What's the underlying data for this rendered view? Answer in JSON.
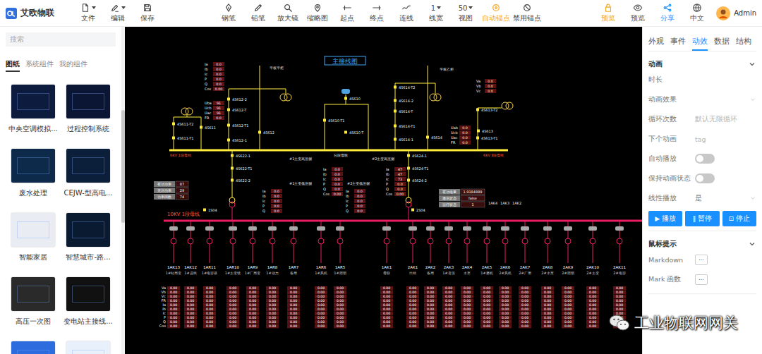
{
  "app": {
    "name": "艾欧物联"
  },
  "menu": [
    {
      "label": "文件",
      "dropdown": true
    },
    {
      "label": "编辑",
      "dropdown": true
    },
    {
      "label": "保存",
      "dropdown": false
    }
  ],
  "tools": [
    {
      "label": "钢笔",
      "selected": false
    },
    {
      "label": "铅笔",
      "selected": false
    },
    {
      "label": "放大镜",
      "selected": false
    },
    {
      "label": "缩略图",
      "selected": false
    },
    {
      "label": "起点",
      "selected": false
    },
    {
      "label": "终点",
      "selected": false
    },
    {
      "label": "连线",
      "selected": false
    },
    {
      "label": "线宽",
      "value": "1",
      "selected": false
    },
    {
      "label": "视图",
      "value": "50",
      "selected": false
    },
    {
      "label": "自动锚点",
      "selected": true
    },
    {
      "label": "禁用锚点",
      "selected": false
    }
  ],
  "actions": [
    {
      "label": "预览",
      "color": "#f5a623"
    },
    {
      "label": "预览",
      "color": "#555555"
    },
    {
      "label": "分享",
      "color": "#1890ff"
    },
    {
      "label": "中文",
      "color": "#555555"
    }
  ],
  "user": {
    "name": "Admin"
  },
  "sidebar": {
    "search_placeholder": "搜索",
    "tabs": [
      {
        "label": "图纸",
        "selected": true
      },
      {
        "label": "系统组件",
        "selected": false
      },
      {
        "label": "我的组件",
        "selected": false
      }
    ],
    "templates": [
      {
        "name": "中央空调模拟...",
        "color": "#0d1b3e"
      },
      {
        "name": "过程控制系统",
        "color": "#0a1633"
      },
      {
        "name": "废水处理",
        "color": "#0e2a4a"
      },
      {
        "name": "CEJW-型高电...",
        "color": "#0b1e3a"
      },
      {
        "name": "智能家居",
        "color": "#e9ecf2"
      },
      {
        "name": "智慧城市-路...",
        "color": "#0a1a30"
      },
      {
        "name": "高压一次图",
        "color": "#2a2a2a"
      },
      {
        "name": "变电站主接线...",
        "color": "#111111"
      },
      {
        "name": "",
        "color": "#2d6cdf"
      },
      {
        "name": "",
        "color": "#e8f0fb"
      }
    ]
  },
  "canvas": {
    "title": "主接线图",
    "buses": [
      {
        "label": "6KV 1段母线",
        "color": "#ffeb3b"
      },
      {
        "label": "6KV Ⅱ段母线",
        "color": "#ffeb3b"
      },
      {
        "label": "10KV 1段母线",
        "color": "#e91e63"
      }
    ],
    "labels": [
      "平板平柜",
      "平板乙柜",
      "分段母联",
      "#1主变高压侧",
      "#2主变高压侧",
      "#1主变低压侧",
      "#2主变低压侧",
      "1AK4",
      "1AK3",
      "1AK2"
    ],
    "breakers": [
      "4S611-T2",
      "4S611",
      "4S611-T1",
      "4S612-2",
      "4S612-T",
      "4S612-T1",
      "4S612-1",
      "4S612",
      "4S610",
      "4S610-T1",
      "4S610-T",
      "4S614-T2",
      "4S614-2",
      "4S614-T",
      "4S614-T1",
      "4S614-1",
      "4S614",
      "4S613-T2",
      "4S613",
      "4S613-T1",
      "4S622-1",
      "4S622-T1",
      "4S622-2",
      "4S624-1",
      "4S624-T1",
      "4S624-2",
      "1S04",
      "2S04"
    ],
    "meters": [
      {
        "rows": [
          {
            "label": "Ia",
            "value": "0.0"
          },
          {
            "label": "Ib",
            "value": "0.0"
          },
          {
            "label": "Ic",
            "value": "0.0"
          },
          {
            "label": "P",
            "value": "0.0"
          },
          {
            "label": "Q",
            "value": "0.0"
          },
          {
            "label": "Cos",
            "value": "0.00"
          }
        ]
      },
      {
        "rows": [
          {
            "label": "Uba",
            "value": "91"
          },
          {
            "label": "Ucb",
            "value": "91"
          },
          {
            "label": "Uac",
            "value": "91"
          },
          {
            "label": "FR",
            "value": "0.0"
          }
        ]
      },
      {
        "rows": [
          {
            "label": "Va",
            "value": "0.0"
          },
          {
            "label": "Vb",
            "value": "0.0"
          },
          {
            "label": "Vc",
            "value": "0.0"
          }
        ]
      },
      {
        "rows": [
          {
            "label": "Uab",
            "value": "0.0"
          },
          {
            "label": "Ucb",
            "value": "0.0"
          },
          {
            "label": "Uac",
            "value": "0.0"
          },
          {
            "label": "FR",
            "value": "0.0"
          }
        ]
      },
      {
        "rows": [
          {
            "label": "Ia",
            "value": "0.0"
          },
          {
            "label": "Ib",
            "value": "0.0"
          },
          {
            "label": "Ic",
            "value": "0.0"
          },
          {
            "label": "P",
            "value": "0.0"
          },
          {
            "label": "Q",
            "value": "0.0"
          },
          {
            "label": "Cos",
            "value": "0.00"
          }
        ]
      },
      {
        "rows": [
          {
            "label": "Ia",
            "value": "47"
          },
          {
            "label": "Ib",
            "value": "47"
          },
          {
            "label": "Ic",
            "value": "73"
          },
          {
            "label": "P",
            "value": "0.0"
          },
          {
            "label": "Q",
            "value": "0.0"
          },
          {
            "label": "Cos",
            "value": "0.00"
          }
        ]
      },
      {
        "rows": [
          {
            "label": "Ia",
            "value": "0.0"
          },
          {
            "label": "Ib",
            "value": "0.0"
          },
          {
            "label": "Ic",
            "value": "0.0"
          },
          {
            "label": "P",
            "value": "0.0"
          },
          {
            "label": "Q",
            "value": "0.0"
          }
        ]
      },
      {
        "rows": [
          {
            "label": "Ia",
            "value": "0.0"
          },
          {
            "label": "Ib",
            "value": "0.0"
          },
          {
            "label": "Ic",
            "value": "0.0"
          },
          {
            "label": "P",
            "value": "0.0"
          },
          {
            "label": "Q",
            "value": "0.0"
          }
        ]
      }
    ],
    "info_boxes": [
      {
        "rows": [
          {
            "label": "有功功率",
            "value": "87"
          },
          {
            "label": "无功功率",
            "value": "29"
          },
          {
            "label": "功率因数",
            "value": "74"
          }
        ]
      },
      {
        "rows": [
          {
            "label": "有功电量",
            "value": "1.9184889"
          },
          {
            "label": "通讯状态",
            "value": "false"
          },
          {
            "label": "运行状态",
            "value": "1"
          }
        ]
      }
    ],
    "table_rows": [
      "Va",
      "Vb",
      "Vc",
      "FR",
      "Ia",
      "Ib",
      "Ic",
      "P",
      "Q",
      "Cos"
    ],
    "feeders": [
      {
        "name": "1AK13",
        "desc": "1#站用变",
        "values": [
          "0.00",
          "0.00",
          "0.00",
          "0.00",
          "0.00",
          "0.00",
          "0.00",
          "0.00",
          "0.00",
          "0.00"
        ]
      },
      {
        "name": "1AK12",
        "desc": "1#进线",
        "values": [
          "0.00",
          "0.00",
          "0.00",
          "0.00",
          "0.00",
          "0.00",
          "0.00",
          "0.00",
          "0.00",
          "0.00"
        ]
      },
      {
        "name": "1AR11",
        "desc": "1#电容器",
        "values": [
          "0.00",
          "0.00",
          "0.00",
          "0.00",
          "0.00",
          "0.00",
          "0.00",
          "0.00",
          "0.00",
          "0.00"
        ]
      },
      {
        "name": "1AR10",
        "desc": "1#主变馈",
        "values": [
          "0.00",
          "0.00",
          "0.00",
          "0.00",
          "0.00",
          "0.00",
          "0.00",
          "0.00",
          "0.00",
          "0.00"
        ]
      },
      {
        "name": "1AR9",
        "desc": "1#厂用变",
        "values": [
          "0.00",
          "0.00",
          "0.00",
          "0.00",
          "0.00",
          "0.00",
          "0.00",
          "0.00",
          "0.00",
          "0.00"
        ]
      },
      {
        "name": "1AR8",
        "desc": "1#动力",
        "values": [
          "0.00",
          "0.00",
          "0.00",
          "0.00",
          "0.00",
          "0.00",
          "0.00",
          "0.00",
          "0.00",
          "0.00"
        ]
      },
      {
        "name": "1AR7",
        "desc": "备用",
        "values": [
          "0.00",
          "0.00",
          "0.00",
          "0.00",
          "0.00",
          "0.00",
          "0.00",
          "0.00",
          "0.00",
          "0.00"
        ]
      },
      {
        "name": "1AR6",
        "desc": "1#风机",
        "values": [
          "0.00",
          "0.00",
          "0.00",
          "0.00",
          "0.00",
          "0.00",
          "0.00",
          "0.00",
          "0.00",
          "0.00"
        ]
      },
      {
        "name": "1AR5",
        "desc": "1#照明",
        "values": [
          "0.00",
          "0.00",
          "0.00",
          "0.00",
          "0.00",
          "0.00",
          "0.00",
          "0.00",
          "0.00",
          "0.00"
        ]
      },
      {
        "name": "1AK1",
        "desc": "母联",
        "values": [
          "0.00",
          "0.00",
          "0.00",
          "0.00",
          "0.00",
          "0.00",
          "0.00",
          "0.00",
          "0.00",
          "0.00"
        ]
      },
      {
        "name": "2AK1",
        "desc": "出线",
        "values": [
          "0.00",
          "0.00",
          "0.00",
          "0.00",
          "0.00",
          "0.00",
          "0.00",
          "0.00",
          "0.00",
          "0.00"
        ]
      },
      {
        "name": "2AK2",
        "desc": "备用",
        "values": [
          "0.00",
          "0.00",
          "0.00",
          "0.00",
          "0.00",
          "0.00",
          "0.00",
          "0.00",
          "0.00",
          "0.00"
        ]
      },
      {
        "name": "2AK3",
        "desc": "1#变压",
        "values": [
          "0.00",
          "0.00",
          "0.00",
          "0.00",
          "0.00",
          "0.00",
          "0.00",
          "0.00",
          "0.00",
          "0.00"
        ]
      },
      {
        "name": "2AK4",
        "desc": "水泵",
        "values": [
          "0.00",
          "0.00",
          "0.00",
          "0.00",
          "0.00",
          "0.00",
          "0.00",
          "0.00",
          "0.00",
          "0.00"
        ]
      },
      {
        "name": "2AK5",
        "desc": "1#磨机",
        "values": [
          "0.00",
          "0.00",
          "0.00",
          "0.00",
          "0.00",
          "0.00",
          "0.00",
          "0.00",
          "0.00",
          "0.00"
        ]
      },
      {
        "name": "2AK6",
        "desc": "2#风机",
        "values": [
          "0.00",
          "0.00",
          "0.00",
          "0.00",
          "0.00",
          "0.00",
          "0.00",
          "0.00",
          "0.00",
          "0.00"
        ]
      },
      {
        "name": "2AK7",
        "desc": "2#厂用",
        "values": [
          "0.00",
          "0.00",
          "0.00",
          "0.00",
          "0.00",
          "0.00",
          "0.00",
          "0.00",
          "0.00",
          "0.00"
        ]
      },
      {
        "name": "2AK8",
        "desc": "2#水泵",
        "values": [
          "0.00",
          "0.00",
          "0.00",
          "0.00",
          "0.00",
          "0.00",
          "0.00",
          "0.00",
          "0.00",
          "0.00"
        ]
      },
      {
        "name": "2AK9",
        "desc": "2#照明",
        "values": [
          "0.00",
          "0.00",
          "0.00",
          "0.00",
          "0.00",
          "0.00",
          "0.00",
          "0.00",
          "0.00",
          "0.00"
        ]
      },
      {
        "name": "2AK10",
        "desc": "2#主变",
        "values": [
          "0.00",
          "0.00",
          "0.00",
          "0.00",
          "0.00",
          "0.00",
          "0.00",
          "0.00",
          "0.00",
          "0.00"
        ]
      },
      {
        "name": "2AK11",
        "desc": "2#电容",
        "values": [
          "0.00",
          "0.00",
          "0.00",
          "0.00",
          "0.00",
          "0.00",
          "0.00",
          "0.00",
          "0.00",
          "0.00"
        ]
      }
    ]
  },
  "inspector": {
    "tabs": [
      {
        "label": "外观",
        "selected": false
      },
      {
        "label": "事件",
        "selected": false
      },
      {
        "label": "动效",
        "selected": true
      },
      {
        "label": "数据",
        "selected": false
      },
      {
        "label": "结构",
        "selected": false
      }
    ],
    "sections": [
      {
        "title": "动画",
        "expanded": true,
        "fields": [
          {
            "kind": "input",
            "label": "时长",
            "value": "",
            "placeholder": ""
          },
          {
            "kind": "select",
            "label": "动画效果",
            "value": ""
          },
          {
            "kind": "input",
            "label": "循环次数",
            "value": "",
            "placeholder": "默认无限循环"
          },
          {
            "kind": "input",
            "label": "下个动画",
            "value": "",
            "placeholder": "tag"
          },
          {
            "kind": "toggle",
            "label": "自动播放",
            "on": false
          },
          {
            "kind": "toggle",
            "label": "保持动画状态",
            "on": false
          },
          {
            "kind": "select",
            "label": "线性播放",
            "value": "是"
          }
        ],
        "buttons": [
          {
            "icon": "▶",
            "label": "播放"
          },
          {
            "icon": "‖",
            "label": "暂停"
          },
          {
            "icon": "⊡",
            "label": "停止"
          }
        ]
      },
      {
        "title": "鼠标提示",
        "expanded": true,
        "fields": [
          {
            "kind": "more",
            "label": "Markdown",
            "value": "..."
          },
          {
            "kind": "more",
            "label": "Mark 函数",
            "value": "..."
          }
        ],
        "buttons": []
      }
    ]
  },
  "watermark": {
    "text": "工业物联网网关"
  }
}
